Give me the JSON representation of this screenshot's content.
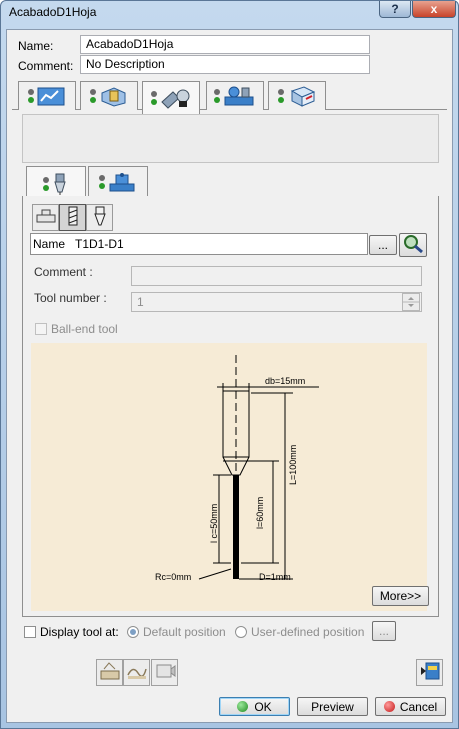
{
  "window": {
    "title": "AcabadoD1Hoja",
    "help": "?",
    "close": "x"
  },
  "form": {
    "name_label": "Name:",
    "name_value": "AcabadoD1Hoja",
    "comment_label": "Comment:",
    "comment_value": "No Description"
  },
  "main_tabs": [
    {
      "icon": "strategy-tab-icon"
    },
    {
      "icon": "geometry-tab-icon"
    },
    {
      "icon": "tool-tab-icon",
      "active": true
    },
    {
      "icon": "feeds-speeds-tab-icon"
    },
    {
      "icon": "macro-tab-icon"
    }
  ],
  "sub_tabs": [
    {
      "icon": "tool-subtab-icon",
      "active": true
    },
    {
      "icon": "assembly-subtab-icon"
    }
  ],
  "tool": {
    "name_label": "Name",
    "name_value": "T1D1-D1",
    "browse_label": "...",
    "comment_label": "Comment :",
    "tool_number_label": "Tool number :",
    "tool_number_value": "1",
    "ball_end_label": "Ball-end tool",
    "more_label": "More>>"
  },
  "diagram": {
    "db": "db=15mm",
    "L": "L=100mm",
    "l": "l=60mm",
    "lc": "l c=50mm",
    "rc": "Rc=0mm",
    "D": "D=1mm"
  },
  "display": {
    "label": "Display tool at:",
    "default_position": "Default position",
    "user_defined_position": "User-defined position",
    "browse_label": "..."
  },
  "buttons": {
    "ok": "OK",
    "preview": "Preview",
    "cancel": "Cancel"
  }
}
